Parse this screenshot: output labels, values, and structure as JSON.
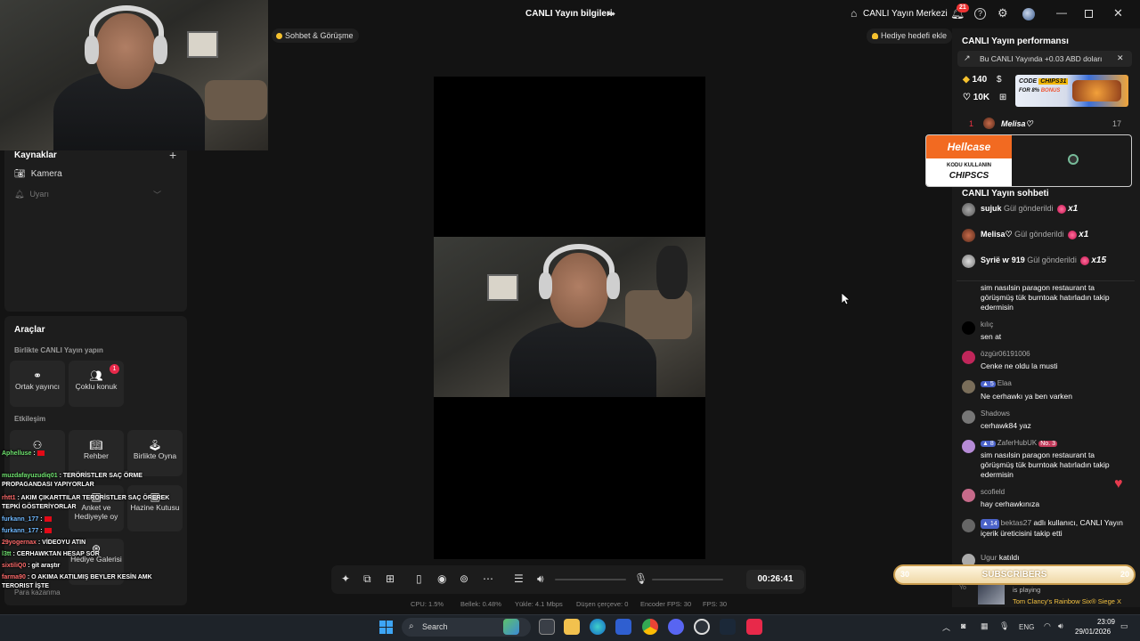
{
  "header": {
    "title": "CANLI Yayın bilgileri",
    "live_center": "CANLI Yayın Merkezi",
    "notif_count": "21"
  },
  "chips": {
    "chat_chip": "Sohbet & Görüşme",
    "gift_chip": "Hediye hedefi ekle"
  },
  "sources": {
    "title": "Kaynaklar",
    "add": "+",
    "camera": "Kamera",
    "alert": "Uyarı"
  },
  "tools": {
    "title": "Araçlar",
    "collab_section": "Birlikte CANLI Yayın yapın",
    "cohost": "Ortak yayıncı",
    "multi_guest": "Çoklu konuk",
    "multi_badge": "1",
    "interaction_section": "Etkileşim",
    "guide": "Rehber",
    "play_together": "Birlikte Oyna",
    "poll": "Anket ve Hediyeyle oy",
    "treasure": "Hazine Kutusu",
    "gift_gallery": "Hediye Galerisi",
    "monetize": "Para kazanma"
  },
  "overlay_chat": [
    {
      "user": "Aphelluse",
      "text": ":",
      "cls": ""
    },
    {
      "user": "muzdafayuzudiq01",
      "text": ": TERÖRİSTLER SAÇ ÖRME PROPAGANDASI YAPIYORLAR",
      "cls": ""
    },
    {
      "user": "rhtt1",
      "text": ": AKIM ÇIKARTTILAR TERÖRİSTLER SAÇ ÖREREK TEPKİ GÖSTERİYORLAR",
      "cls": "r"
    },
    {
      "user": "furkann_177",
      "text": ":",
      "cls": "b"
    },
    {
      "user": "furkann_177",
      "text": ":",
      "cls": "b"
    },
    {
      "user": "29yogernax",
      "text": ": VİDEOYU ATIN",
      "cls": "r"
    },
    {
      "user": "l3tt",
      "text": ": CERHAWKTAN HESAP SOR",
      "cls": ""
    },
    {
      "user": "sixtiliQ0",
      "text": ": git araştır",
      "cls": "r"
    },
    {
      "user": "farma90",
      "text": ": O AKIMA KATILMIŞ BEYLER KESİN AMK TERORIST İŞTE",
      "cls": "r"
    }
  ],
  "controls": {
    "timer": "00:26:41"
  },
  "stats": {
    "cpu": "CPU: 1.5%",
    "memory": "Bellek: 0.48%",
    "upload": "Yükle: 4.1 Mbps",
    "dropped": "Düşen çerçeve: 0",
    "encoder_fps": "Encoder FPS: 30",
    "fps": "FPS: 30"
  },
  "performance": {
    "title": "CANLI Yayın performansı",
    "earnings": "Bu CANLI Yayında +0.03 ABD doları",
    "diamonds": "140",
    "likes": "10K",
    "ad_code": "CODE",
    "ad_code_value": "CHIPS31",
    "ad_bonus_prefix": "FOR 8%",
    "ad_bonus": "BONUS",
    "rank_number": "1",
    "rank_name": "Melisa♡",
    "rank_score": "17"
  },
  "hellcase": {
    "brand": "Hellcase",
    "line1": "KODU KULLANIN",
    "line2": "CHIPSCS"
  },
  "live_chat": {
    "title": "CANLI Yayın sohbeti",
    "gifts": [
      {
        "user": "sujuk",
        "text": "Gül gönderildi",
        "count": "x1"
      },
      {
        "user": "Melisa♡",
        "text": "Gül gönderildi",
        "count": "x1"
      },
      {
        "user": "Syriё ⱳ 919",
        "text": "Gül gönderildi",
        "count": "x15"
      }
    ],
    "messages": [
      {
        "name": "",
        "text": "sim nasılsin paragon restaurant ta görüşmüş tük burntoak hatırladın takip edermisin"
      },
      {
        "name": "kılıç",
        "text": "sen at"
      },
      {
        "name": "özgür06191006",
        "text": "Cenke ne oldu la musti"
      },
      {
        "name": "Elaa",
        "level": "5",
        "text": "Ne cerhawkı ya ben varken"
      },
      {
        "name": "Shadows",
        "text": "cerhawk84 yaz"
      },
      {
        "name": "ZaferHubUK",
        "level": "8",
        "fan": "No. 3",
        "text": "sim nasılsin paragon restaurant ta görüşmüş tük burntoak hatırladın takip edermisin"
      },
      {
        "name": "scofield",
        "text": "hay cerhawkınıza"
      },
      {
        "name": "bektas27",
        "level": "14",
        "text": "adlı kullanıcı, CANLI Yayın içerik üreticisini takip etti"
      },
      {
        "name": "Ugur",
        "text": "katıldı"
      }
    ]
  },
  "subs": {
    "left": "30",
    "label": "SUBSCRIBERS",
    "right": "20"
  },
  "game": {
    "you": "Yo",
    "playing": "is playing",
    "name": "Tom Clancy's Rainbow Six® Siege X"
  },
  "taskbar": {
    "search": "Search",
    "lang": "ENG",
    "time": "23:09",
    "date": "29/01/2026"
  }
}
